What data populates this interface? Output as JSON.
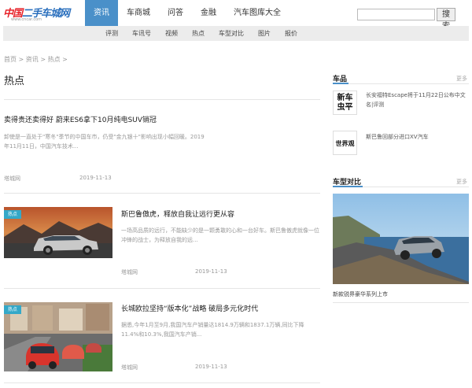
{
  "header": {
    "logo_text_red": "中国",
    "logo_text_blue": "二手车城网",
    "logo_sub": "www.cncar.com",
    "nav": [
      "资讯",
      "车商城",
      "问答",
      "金融",
      "汽车图库大全"
    ],
    "search_button": "搜 索",
    "subnav": [
      "评测",
      "车讯号",
      "视频",
      "热点",
      "车型对比",
      "图片",
      "报价"
    ]
  },
  "breadcrumb": "首页 > 资讯 > 热点 >",
  "page_title": "热点",
  "articles": [
    {
      "title": "卖得贵还卖得好 蔚来ES6拿下10月纯电SUV销冠",
      "summary": "卸使是一直处于\"寒冬\"季节的中国车市，仍受\"金九银十\"影响出现小幅回暖。2019年11月11日，中国汽车技术...",
      "source": "塔城网",
      "date": "2019-11-13"
    },
    {
      "title": "斯巴鲁傲虎，释放自我让远行更从容",
      "summary": "一场高品质的远行，不能缺少的是一颗勇敢的心和一台好车。斯巴鲁傲虎就像一位冲锋的战士，为释放自我的远...",
      "source": "塔城网",
      "date": "2019-11-13",
      "tag": "热点"
    },
    {
      "title": "长城欧拉坚持“版本化”战略 破局多元化时代",
      "summary": "据悉,今年1月至9月,我国汽车产销量达1814.9万辆和1837.1万辆,同比下降11.4%和10.3%,我国汽车产销...",
      "source": "塔城网",
      "date": "2019-11-13",
      "tag": "热点"
    }
  ],
  "sidebar": {
    "chepin": {
      "heading": "车品",
      "more": "更多",
      "items": [
        {
          "logo": "新车\n虫平",
          "text": "长安福特Escape将于11月22日公布中文名|评测"
        },
        {
          "logo": "世界观",
          "text": "斯巴鲁回部分进口XV汽车"
        }
      ]
    },
    "compare": {
      "heading": "车型对比",
      "more": "更多",
      "caption": "新款锐界豪华系列上市"
    }
  },
  "colors": {
    "accent": "#4a90c9",
    "tag": "#34a8c8",
    "logo_red": "#e8242b"
  }
}
